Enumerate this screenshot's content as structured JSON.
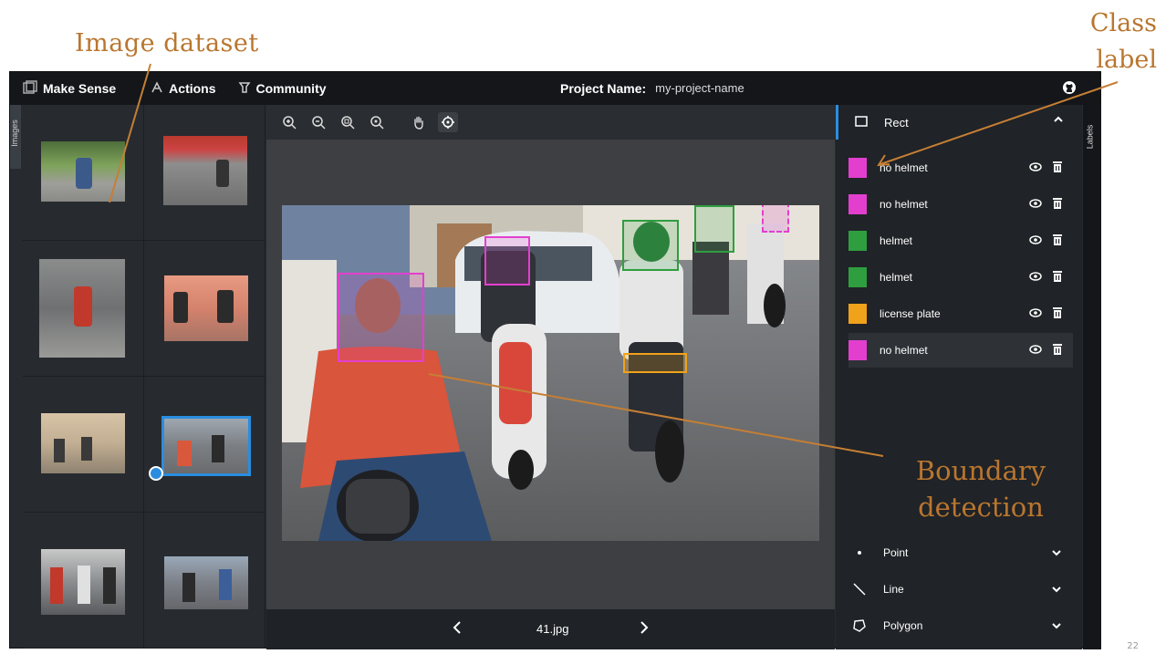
{
  "annotations": {
    "image_dataset": "Image dataset",
    "class_label_line1": "Class",
    "class_label_line2": "label",
    "boundary_line1": "Boundary",
    "boundary_line2": "detection",
    "slide_number": "22"
  },
  "topbar": {
    "brand": "Make Sense",
    "actions": "Actions",
    "community": "Community",
    "project_label": "Project Name:",
    "project_value": "my-project-name"
  },
  "left_tab": {
    "label": "Images"
  },
  "right_tab": {
    "label": "Labels"
  },
  "editor": {
    "filename": "41.jpg",
    "tools": [
      "zoom-in-icon",
      "zoom-out-icon",
      "zoom-fit-icon",
      "zoom-reset-icon",
      "hand-icon",
      "crosshair-icon"
    ]
  },
  "labels_panel": {
    "header": "Rect",
    "items": [
      {
        "name": "no helmet",
        "color": "#e33fcf"
      },
      {
        "name": "no helmet",
        "color": "#e33fcf"
      },
      {
        "name": "helmet",
        "color": "#2f9e3f"
      },
      {
        "name": "helmet",
        "color": "#2f9e3f"
      },
      {
        "name": "license plate",
        "color": "#f0a21a"
      },
      {
        "name": "no helmet",
        "color": "#e33fcf"
      }
    ],
    "tools": [
      {
        "name": "Point",
        "icon": "point-icon"
      },
      {
        "name": "Line",
        "icon": "line-icon"
      },
      {
        "name": "Polygon",
        "icon": "polygon-icon"
      }
    ]
  },
  "colors": {
    "accent": "#2a8de0",
    "annotation": "#b9762f"
  }
}
